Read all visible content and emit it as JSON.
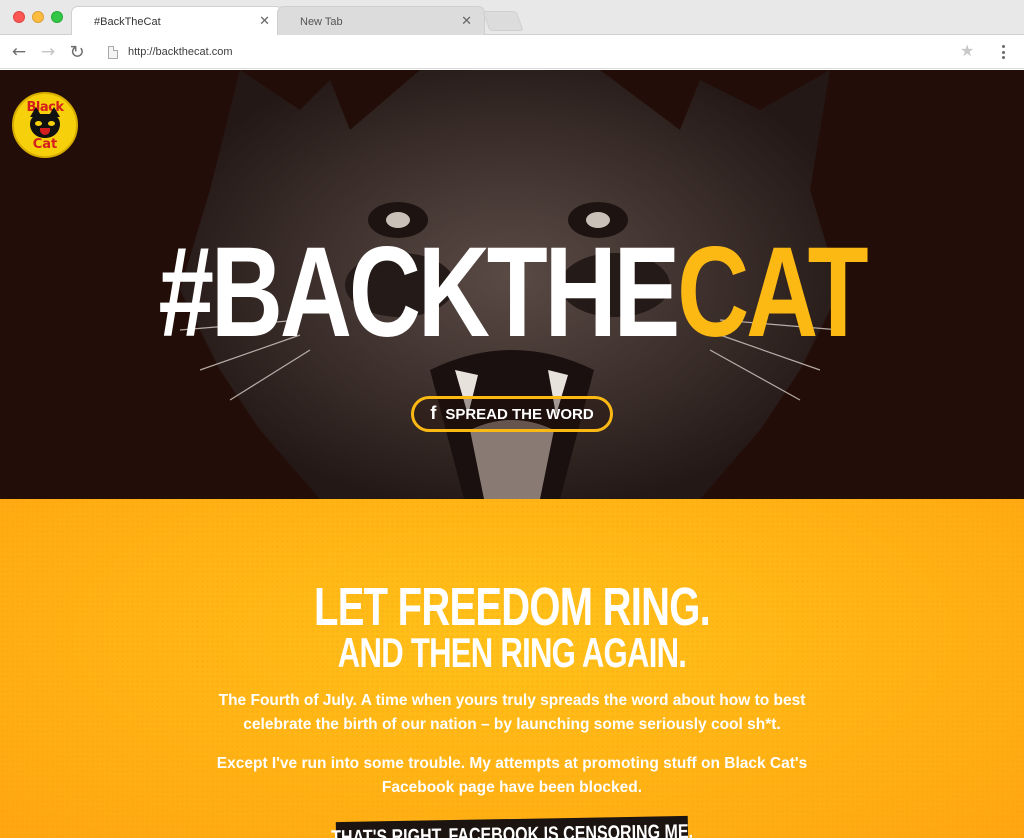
{
  "browser": {
    "tabs": [
      {
        "title": "#BackTheCat",
        "active": true
      },
      {
        "title": "New Tab",
        "active": false
      }
    ],
    "url": "http://backthecat.com"
  },
  "hero": {
    "logo": {
      "line1": "Black",
      "line2": "Cat"
    },
    "title_white": "#BACKTHE",
    "title_yellow": "CAT",
    "share_button": {
      "icon": "f",
      "label": "SPREAD THE WORD"
    }
  },
  "intro": {
    "heading": "LET FREEDOM RING.",
    "subheading": "AND THEN RING AGAIN.",
    "paragraph1": "The Fourth of July. A time when yours truly spreads the word about how to best celebrate the birth of our nation – by launching some seriously cool sh*t.",
    "paragraph2": "Except I've run into some trouble. My attempts at promoting stuff on Black Cat's Facebook page have been blocked.",
    "banner": "THAT'S RIGHT. FACEBOOK IS CENSORING ME."
  },
  "colors": {
    "accent_yellow": "#fdb913",
    "hero_bg": "#230d08",
    "orange_bg": "#ffb315"
  }
}
